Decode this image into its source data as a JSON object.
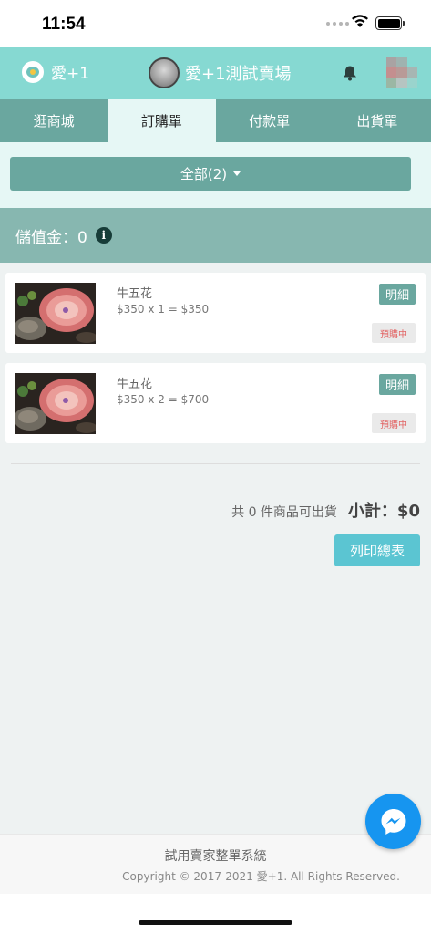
{
  "status_bar": {
    "time": "11:54"
  },
  "header": {
    "brand": "愛+1",
    "shop_name": "愛+1測試賣場"
  },
  "tabs": [
    {
      "label": "逛商城",
      "active": false
    },
    {
      "label": "訂購單",
      "active": true
    },
    {
      "label": "付款單",
      "active": false
    },
    {
      "label": "出貨單",
      "active": false
    }
  ],
  "filter": {
    "label": "全部(2)"
  },
  "balance": {
    "text": "儲值金：0"
  },
  "orders": [
    {
      "name": "牛五花",
      "price_line": "$350 x 1 = $350",
      "detail_label": "明細",
      "status": "預購中"
    },
    {
      "name": "牛五花",
      "price_line": "$350 x 2 = $700",
      "detail_label": "明細",
      "status": "預購中"
    }
  ],
  "summary": {
    "count_text": "共 0 件商品可出貨",
    "total_text": "小計：$0"
  },
  "print_button": "列印總表",
  "footer": {
    "title": "試用賣家整單系統",
    "copyright": "Copyright © 2017-2021 愛+1. All Rights Reserved."
  },
  "colors": {
    "header_bg": "#86d9d2",
    "tab_bg": "#6aa79f",
    "tab_active_bg": "#e6f7f5",
    "balance_bg": "#87b7b0",
    "print_btn": "#5bc5d2",
    "messenger": "#1695f0",
    "status_text": "#e26464"
  },
  "icons": [
    "wifi-icon",
    "battery-icon",
    "brand-logo-icon",
    "bell-icon",
    "info-icon",
    "messenger-icon",
    "caret-down-icon"
  ]
}
